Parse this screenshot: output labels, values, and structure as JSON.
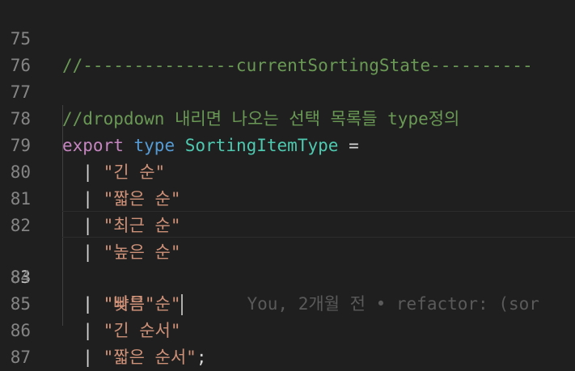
{
  "editor": {
    "active_line": 83,
    "lines": [
      {
        "n": "75",
        "comment": "//---------------currentSortingState----------"
      },
      {
        "n": "76"
      },
      {
        "n": "77",
        "comment": "//dropdown 내리면 나오는 선택 목록들 type정의"
      },
      {
        "n": "78",
        "kw": "export",
        "ty": "type",
        "name": "SortingItemType",
        "op": "="
      },
      {
        "n": "79",
        "str": "\"긴 순\""
      },
      {
        "n": "80",
        "str": "\"짧은 순\""
      },
      {
        "n": "81",
        "str": "\"최근 순\""
      },
      {
        "n": "82",
        "str": "\"높은 순\""
      },
      {
        "n": "83",
        "str": "\"낮은 순\"",
        "blame": "You, 2개월 전 • refactor: (sor"
      },
      {
        "n": "84",
        "str": "\"빠름\""
      },
      {
        "n": "85",
        "str": "\"긴 순서\""
      },
      {
        "n": "86",
        "str": "\"짧은 순서\"",
        "end": ";"
      },
      {
        "n": "87"
      }
    ],
    "pipe": "|"
  }
}
